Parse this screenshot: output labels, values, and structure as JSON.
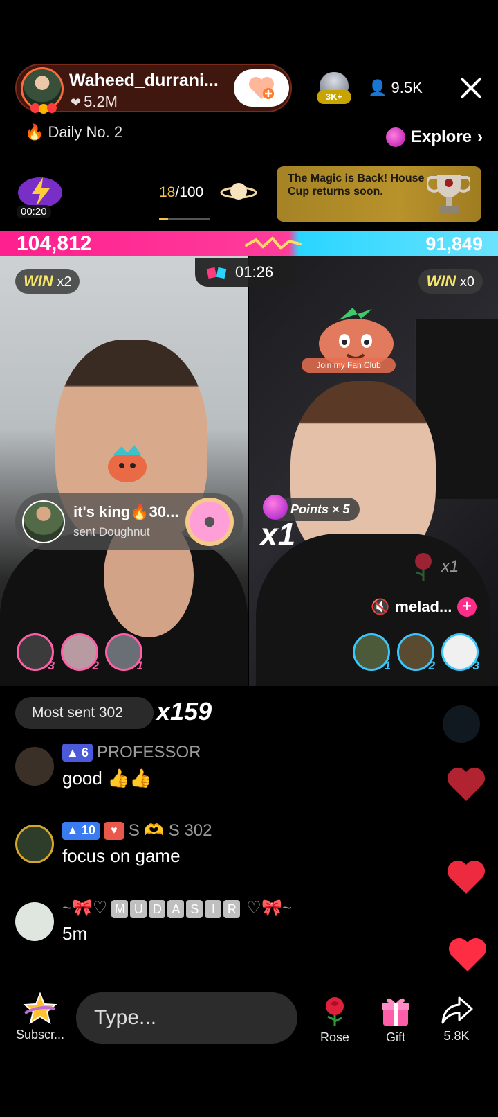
{
  "host": {
    "name": "Waheed_durrani...",
    "likes": "5.2M",
    "level_badge": "3K+",
    "viewers": "9.5K",
    "daily": "Daily No. 2",
    "explore": "Explore"
  },
  "flash": {
    "timer": "00:20"
  },
  "progress": {
    "done": "18",
    "total": "/100",
    "fraction": 0.18
  },
  "promo": {
    "text": "The Magic is Back! House Cup returns soon."
  },
  "battle": {
    "score_left": "104,812",
    "score_right": "91,849",
    "timer": "01:26",
    "left": {
      "win_label": "WIN",
      "win_count": "x2"
    },
    "right": {
      "win_label": "WIN",
      "win_count": "x0"
    },
    "fan_club": "Join my Fan Club"
  },
  "gift_banner": {
    "name": "it's king🔥30...",
    "sub": "sent Doughnut"
  },
  "points": {
    "label": "Points × 5",
    "multiplier": "x1",
    "rose_count": "x1"
  },
  "guest": {
    "name": "melad...",
    "plus": "+"
  },
  "ranks_left": [
    "3",
    "2",
    "1"
  ],
  "ranks_right": [
    "1",
    "2",
    "3"
  ],
  "most_sent": {
    "label": "Most sent 302",
    "combo": "x159"
  },
  "messages": [
    {
      "level": "6",
      "name": "PROFESSOR",
      "text": "good 👍👍"
    },
    {
      "level": "10",
      "name_a": "S",
      "name_b": "S  302",
      "text": "focus on game"
    },
    {
      "name_pre": "~🎀♡",
      "tiles": [
        "M",
        "U",
        "D",
        "A",
        "S",
        "I",
        "R"
      ],
      "name_post": "♡🎀~",
      "text": "5m"
    }
  ],
  "bottom": {
    "subscribe": "Subscr...",
    "type_placeholder": "Type...",
    "rose": "Rose",
    "gift": "Gift",
    "share_count": "5.8K"
  },
  "colors": {
    "accent_pink": "#ff1f8f",
    "accent_blue": "#29d5ff",
    "win_yellow": "#f5e46a",
    "heart_red": "#e6243b"
  }
}
